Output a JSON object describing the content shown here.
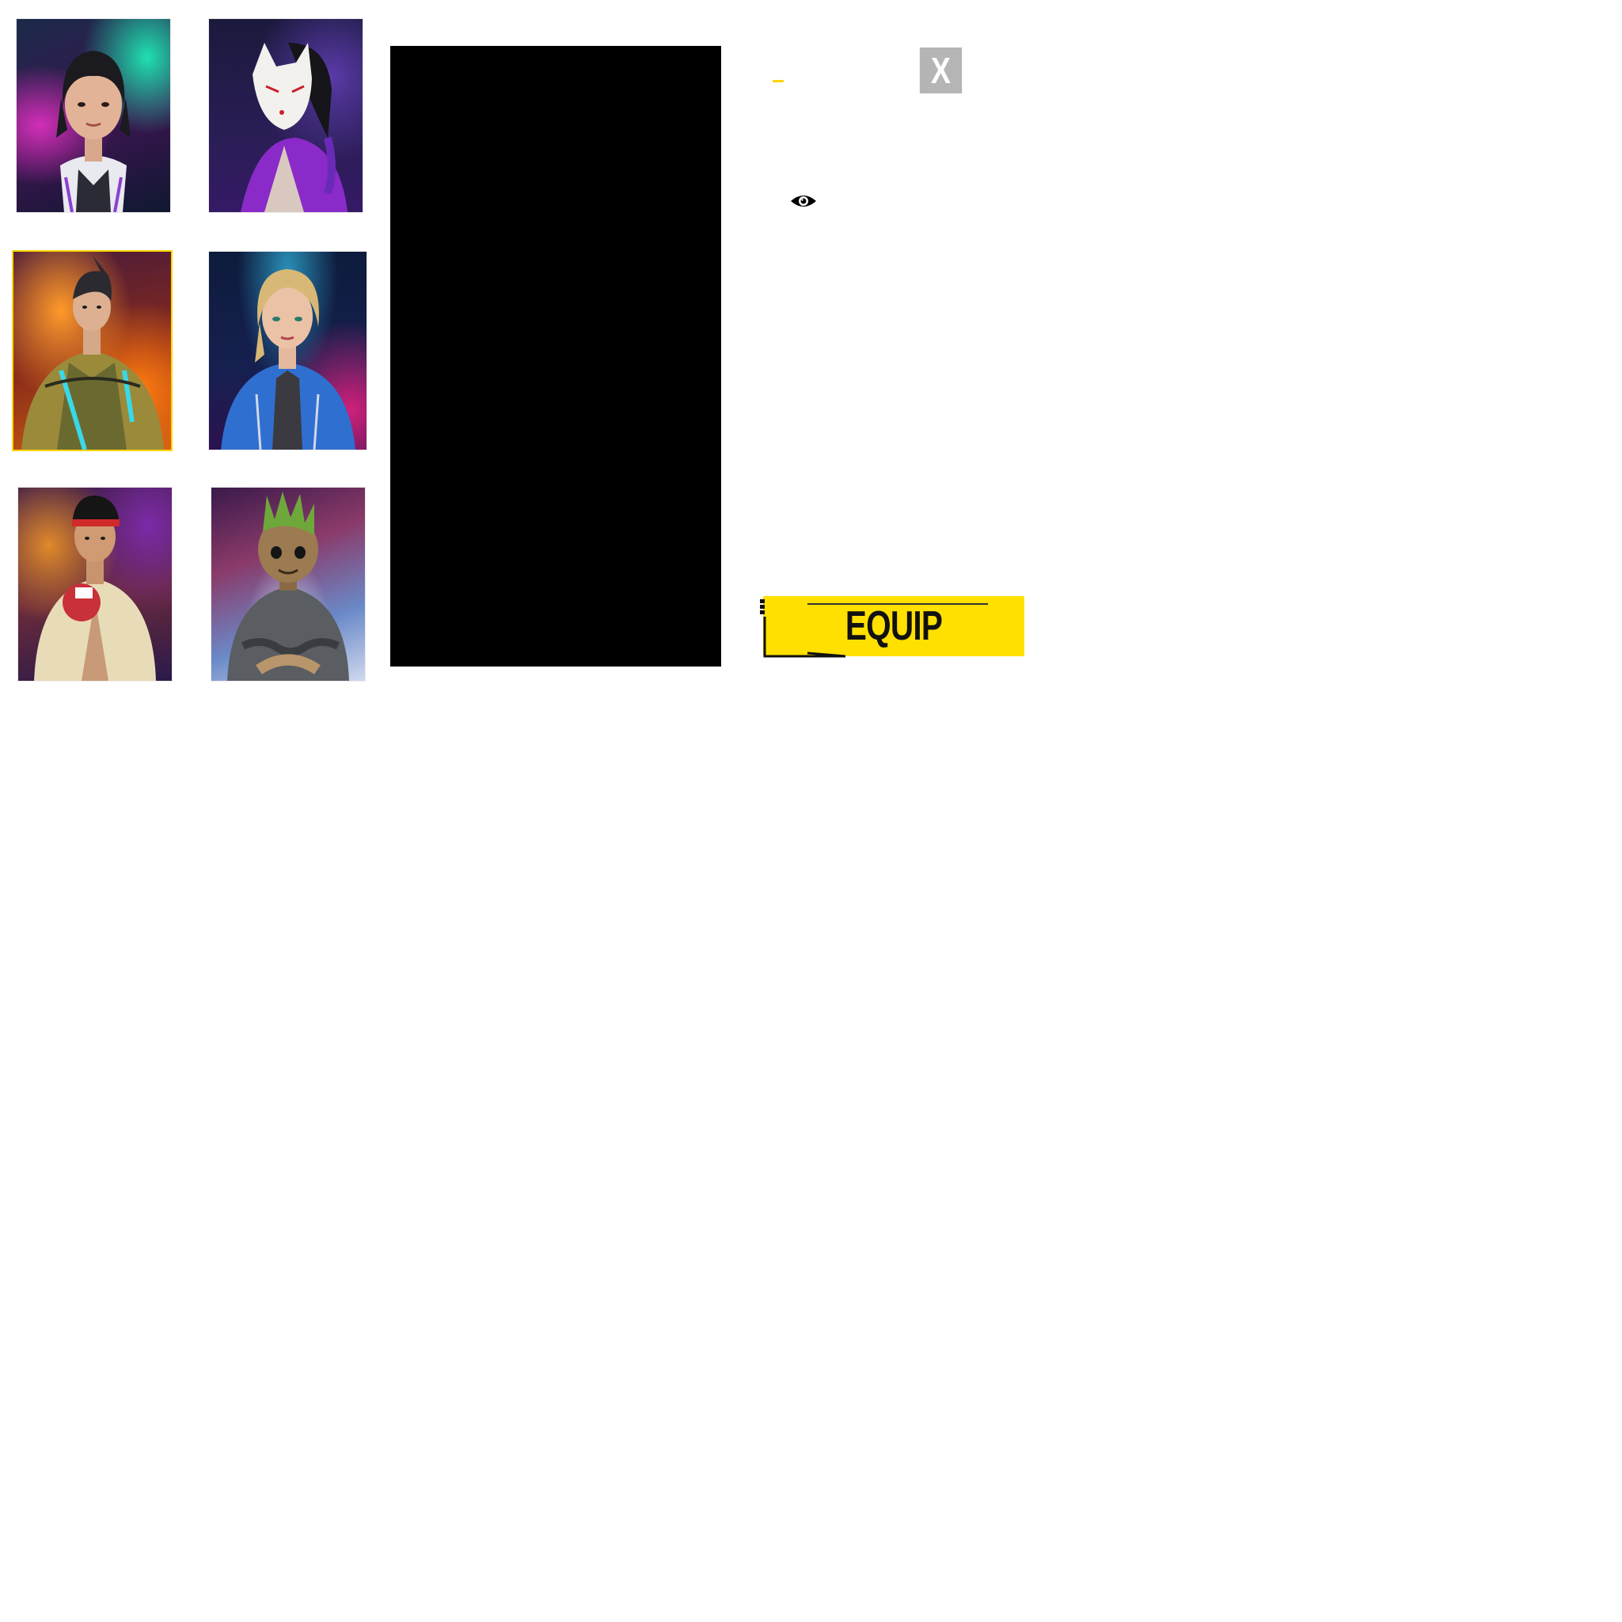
{
  "characters": [
    {
      "id": "tile-1",
      "selected": false
    },
    {
      "id": "tile-2",
      "selected": false
    },
    {
      "id": "tile-3",
      "selected": true
    },
    {
      "id": "tile-4",
      "selected": false
    },
    {
      "id": "tile-5",
      "selected": false
    },
    {
      "id": "tile-6",
      "selected": false
    }
  ],
  "details": {
    "close_label": "X",
    "rarity_color": "#ffd400",
    "preview_icon": "eye-icon"
  },
  "actions": {
    "equip_label": "EQUIP",
    "equip_color": "#ffe000"
  }
}
